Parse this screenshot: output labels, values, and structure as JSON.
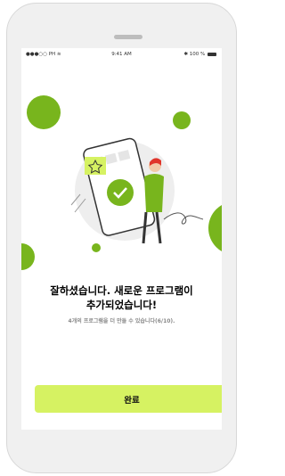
{
  "status_bar": {
    "carrier": "●●●○○ PH",
    "wifi_icon": "wifi-icon",
    "time": "9:41 AM",
    "battery_text": "100 %"
  },
  "illustration": {
    "description_icons": [
      "phone-icon",
      "star-icon",
      "checkmark-icon",
      "person-icon"
    ],
    "accent_color": "#78b51d",
    "highlight_color": "#d6f262"
  },
  "message": {
    "title_line1": "잘하셨습니다. 새로운 프로그램이",
    "title_line2": "추가되었습니다!",
    "subtitle": "4개의 프로그램을 더 만들 수 있습니다(6/10)."
  },
  "actions": {
    "done_label": "완료"
  },
  "colors": {
    "button_bg": "#d6f262",
    "dot_green": "#78b51d"
  }
}
